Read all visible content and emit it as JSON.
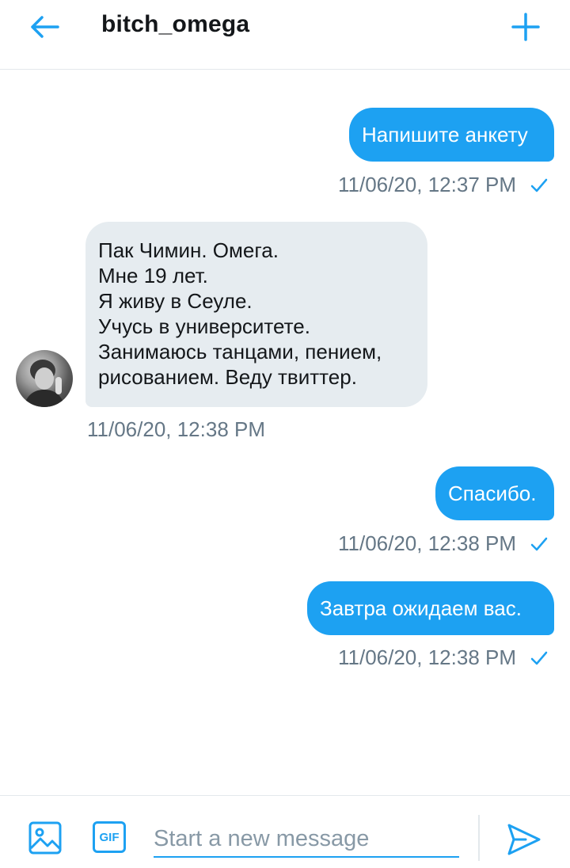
{
  "header": {
    "title": "bitch_omega",
    "back_icon": "arrow-left-icon",
    "add_icon": "plus-icon"
  },
  "messages": [
    {
      "direction": "sent",
      "text": "Напишите анкету",
      "timestamp": "11/06/20, 12:37 PM",
      "read": true
    },
    {
      "direction": "received",
      "lines": [
        "Пак Чимин. Омега.",
        "Мне 19 лет.",
        "Я живу в Сеуле.",
        "Учусь в университете.",
        "Занимаюсь танцами, пением,",
        "рисованием. Веду твиттер."
      ],
      "timestamp": "11/06/20, 12:38 PM"
    },
    {
      "direction": "sent",
      "text": "Спасибо.",
      "timestamp": "11/06/20, 12:38 PM",
      "read": true
    },
    {
      "direction": "sent",
      "text": "Завтра ожидаем вас.",
      "timestamp": "11/06/20, 12:38 PM",
      "read": true
    }
  ],
  "compose": {
    "placeholder": "Start a new message",
    "gif_label": "GIF",
    "image_icon": "image-icon",
    "send_icon": "send-icon"
  },
  "colors": {
    "accent": "#1da1f2",
    "received_bubble": "#e6ecf0",
    "meta_text": "#657786",
    "text": "#14171a"
  }
}
